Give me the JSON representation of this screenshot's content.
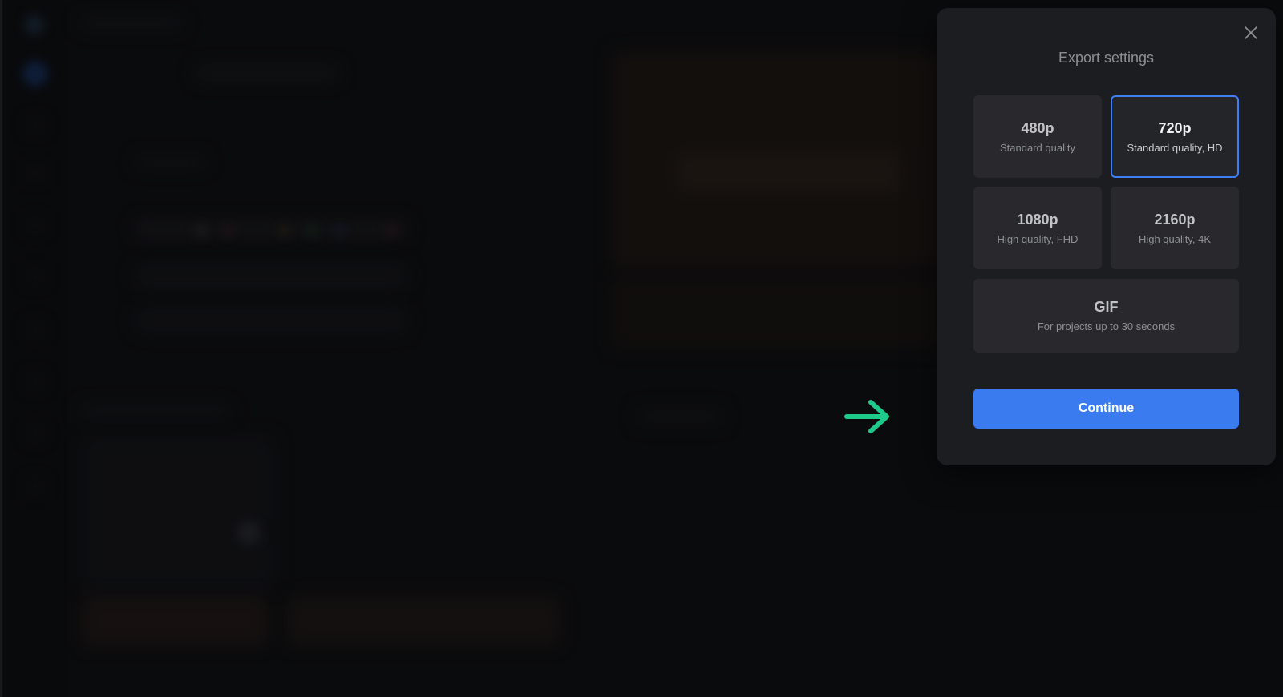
{
  "modal": {
    "title": "Export settings",
    "close_icon": "close-icon",
    "options": [
      {
        "title": "480p",
        "subtitle": "Standard quality",
        "selected": false
      },
      {
        "title": "720p",
        "subtitle": "Standard quality, HD",
        "selected": true
      },
      {
        "title": "1080p",
        "subtitle": "High quality, FHD",
        "selected": false
      },
      {
        "title": "2160p",
        "subtitle": "High quality, 4K",
        "selected": false
      },
      {
        "title": "GIF",
        "subtitle": "For projects up to 30 seconds",
        "selected": false
      }
    ],
    "continue_label": "Continue"
  },
  "colors": {
    "accent": "#3a7bf0",
    "selected_border": "#3e7ff2",
    "arrow": "#1fc98a",
    "modal_bg": "#1c1d20",
    "option_bg": "#29292d"
  },
  "arrow_icon": "arrow-right-icon"
}
